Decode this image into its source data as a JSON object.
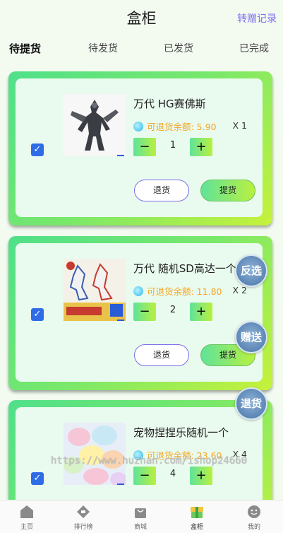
{
  "header": {
    "title": "盒柜",
    "link": "转赠记录"
  },
  "tabs": [
    {
      "label": "待提货",
      "active": true
    },
    {
      "label": "待发货",
      "active": false
    },
    {
      "label": "已发货",
      "active": false
    },
    {
      "label": "已完成",
      "active": false
    }
  ],
  "items": [
    {
      "name": "万代 HG赛佛斯",
      "refund_label": "可退货余额: 5.90",
      "qty": "X 1",
      "count": "1",
      "checked": true,
      "refund_btn": "退货",
      "pickup_btn": "提货"
    },
    {
      "name": "万代 随机SD高达一个",
      "refund_label": "可退货余额: 11.80",
      "qty": "X 2",
      "count": "2",
      "checked": true,
      "refund_btn": "退货",
      "pickup_btn": "提货"
    },
    {
      "name": "宠物捏捏乐随机一个",
      "refund_label": "可退货余额: 23.60",
      "qty": "X 4",
      "count": "4",
      "checked": true
    }
  ],
  "float_buttons": {
    "select_all": "反选",
    "gift": "赠送",
    "return": "退货"
  },
  "watermark": "https://www.huzhan.com/ishop24660",
  "nav": [
    {
      "label": "主页",
      "icon": "home-icon"
    },
    {
      "label": "排行榜",
      "icon": "ranking-icon"
    },
    {
      "label": "商城",
      "icon": "shop-bag-icon"
    },
    {
      "label": "盒柜",
      "icon": "box-cabinet-icon",
      "active": true
    },
    {
      "label": "我的",
      "icon": "profile-icon"
    }
  ],
  "colors": {
    "accent": "#7b6cf0",
    "refund": "#f5a623",
    "check": "#2f6de8"
  }
}
